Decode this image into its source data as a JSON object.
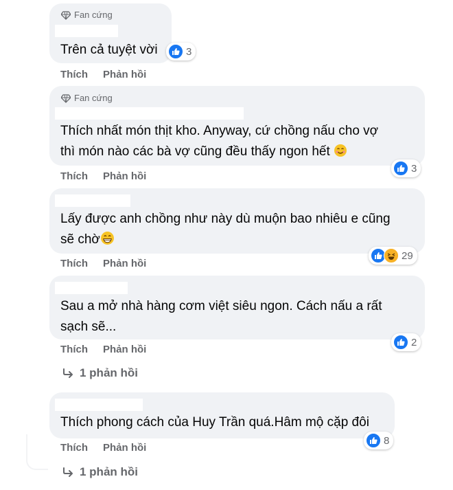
{
  "actions": {
    "like": "Thích",
    "reply": "Phản hồi"
  },
  "comments": [
    {
      "badge": "Fan cứng",
      "lines": [
        "Trên cả tuyệt vời"
      ],
      "reaction_count": "3"
    },
    {
      "badge": "Fan cứng",
      "lines": [
        "Thích nhất món thịt kho. Anyway, cứ chồng nấu cho vợ",
        "thì món nào các bà vợ cũng đều thấy ngon hết"
      ],
      "reaction_count": "3"
    },
    {
      "lines": [
        "Lấy được anh chồng như này dù muộn bao nhiêu e cũng",
        "sẽ chờ"
      ],
      "reaction_count": "29"
    },
    {
      "lines": [
        "Sau a mở nhà hàng cơm việt siêu ngon. Cách nấu a rất",
        "sạch sẽ..."
      ],
      "reaction_count": "2",
      "replies": "1 phản hồi"
    },
    {
      "lines": [
        "Thích phong cách của Huy Trần quá.Hâm mộ cặp đôi"
      ],
      "reaction_count": "8",
      "replies": "1 phản hồi"
    }
  ],
  "icons": {
    "badge": "diamond-icon",
    "like": "thumbs-up-icon",
    "haha": "laughing-icon",
    "reply_arrow": "reply-arrow-icon",
    "smile": "smiling-face-icon",
    "grin": "grinning-face-icon"
  },
  "colors": {
    "bubble": "#f0f2f5",
    "like_blue": "#1877f2",
    "meta_gray": "#65676b"
  }
}
